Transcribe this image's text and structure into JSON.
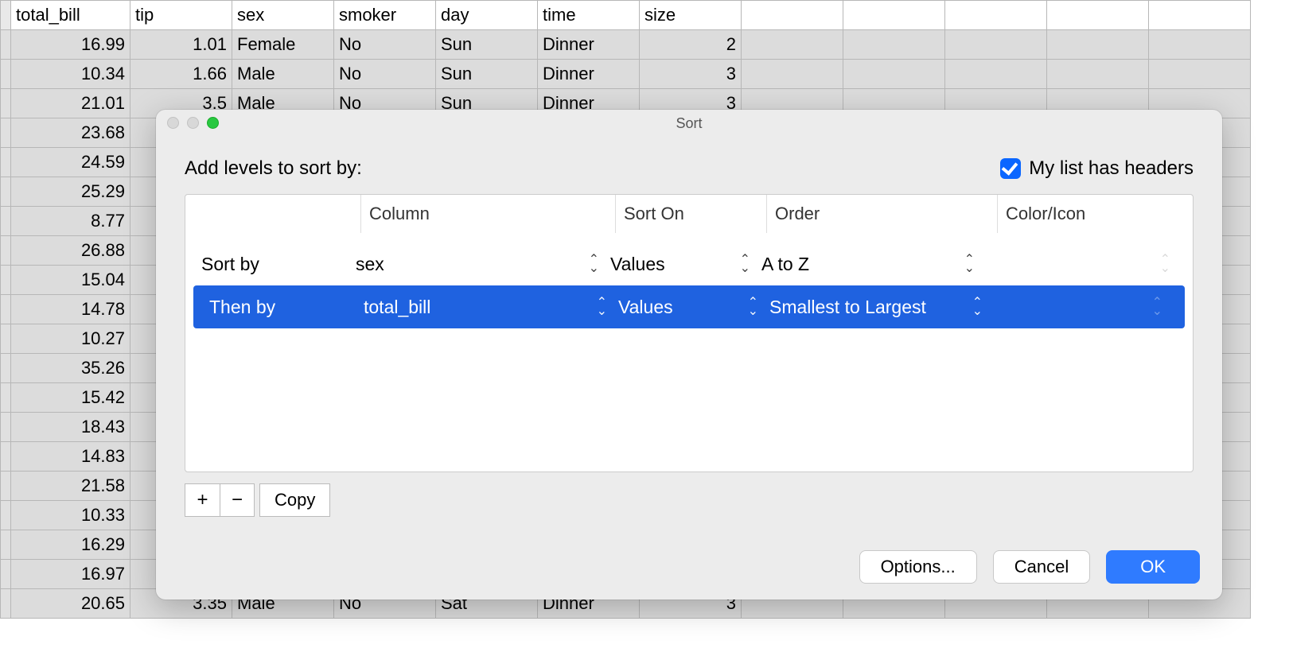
{
  "sheet": {
    "headers": [
      "total_bill",
      "tip",
      "sex",
      "smoker",
      "day",
      "time",
      "size"
    ],
    "rows": [
      {
        "total_bill": "16.99",
        "tip": "1.01",
        "sex": "Female",
        "smoker": "No",
        "day": "Sun",
        "time": "Dinner",
        "size": "2"
      },
      {
        "total_bill": "10.34",
        "tip": "1.66",
        "sex": "Male",
        "smoker": "No",
        "day": "Sun",
        "time": "Dinner",
        "size": "3"
      },
      {
        "total_bill": "21.01",
        "tip": "3.5",
        "sex": "Male",
        "smoker": "No",
        "day": "Sun",
        "time": "Dinner",
        "size": "3"
      },
      {
        "total_bill": "23.68"
      },
      {
        "total_bill": "24.59"
      },
      {
        "total_bill": "25.29"
      },
      {
        "total_bill": "8.77"
      },
      {
        "total_bill": "26.88"
      },
      {
        "total_bill": "15.04"
      },
      {
        "total_bill": "14.78"
      },
      {
        "total_bill": "10.27"
      },
      {
        "total_bill": "35.26"
      },
      {
        "total_bill": "15.42"
      },
      {
        "total_bill": "18.43"
      },
      {
        "total_bill": "14.83"
      },
      {
        "total_bill": "21.58"
      },
      {
        "total_bill": "10.33"
      },
      {
        "total_bill": "16.29"
      },
      {
        "total_bill": "16.97"
      },
      {
        "total_bill": "20.65",
        "tip": "3.35",
        "sex": "Male",
        "smoker": "No",
        "day": "Sat",
        "time": "Dinner",
        "size": "3"
      }
    ]
  },
  "dialog": {
    "title": "Sort",
    "instruction": "Add levels to sort by:",
    "headers_checkbox_label": "My list has headers",
    "list_headers": {
      "column": "Column",
      "sorton": "Sort On",
      "order": "Order",
      "coloricon": "Color/Icon"
    },
    "levels": [
      {
        "label": "Sort by",
        "column": "sex",
        "sorton": "Values",
        "order": "A to Z",
        "selected": false
      },
      {
        "label": "Then by",
        "column": "total_bill",
        "sorton": "Values",
        "order": "Smallest to Largest",
        "selected": true
      }
    ],
    "buttons": {
      "plus": "+",
      "minus": "−",
      "copy": "Copy",
      "options": "Options...",
      "cancel": "Cancel",
      "ok": "OK"
    }
  }
}
